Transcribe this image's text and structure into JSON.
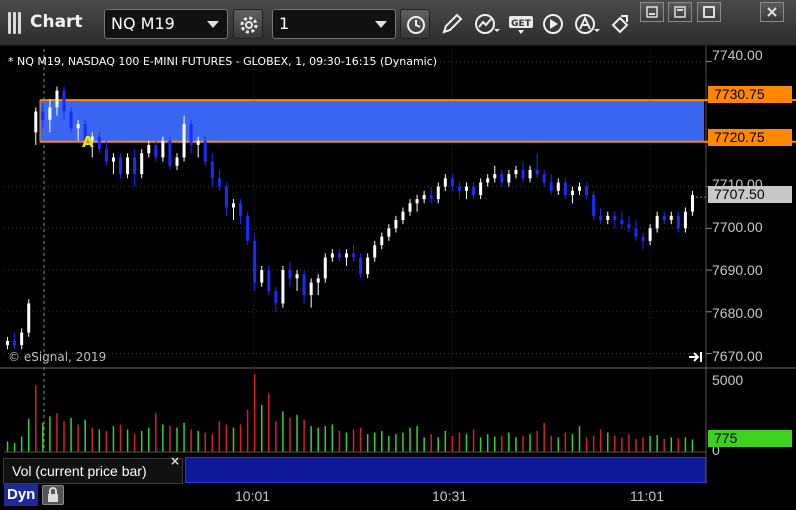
{
  "window": {
    "title": "Chart",
    "symbol": "NQ M19",
    "interval": "1"
  },
  "toolbar": {
    "icons": [
      "settings-gear-icon",
      "clock-icon",
      "pencil-draw-icon",
      "study-icon",
      "get-data-icon",
      "play-icon",
      "alert-icon",
      "link-icon"
    ]
  },
  "chart": {
    "description": "* NQ M19, NASDAQ 100 E-MINI FUTURES - GLOBEX, 1, 09:30-16:15 (Dynamic)",
    "copyright": "© eSignal, 2019",
    "marker": "A",
    "price_axis": [
      "7740.00",
      "7710.00",
      "7700.00",
      "7690.00",
      "7680.00",
      "7670.00"
    ],
    "zone_top_label": "7730.75",
    "zone_bottom_label": "7720.75",
    "last_price_label": "7707.50",
    "time_axis": [
      "10:01",
      "10:31",
      "11:01"
    ],
    "colors": {
      "up": "#ffffff",
      "down": "#1a2bff",
      "zone": "#3d6bff",
      "zone_border": "#ff8800",
      "volume_up": "#2fd62f",
      "volume_down": "#d82020"
    }
  },
  "volume": {
    "label": "Vol (current price bar)",
    "close": "×",
    "axis_max": "5000",
    "axis_min": "0",
    "current_label": "775"
  },
  "footer": {
    "mode": "Dyn"
  },
  "chart_data": {
    "type": "candlestick",
    "y_range": [
      7667,
      7743
    ],
    "zone": [
      7720.75,
      7730.75
    ],
    "last": 7707.5,
    "price_axis_values": [
      7740,
      7710,
      7700,
      7690,
      7680,
      7670
    ],
    "time_ticks": [
      "10:01",
      "10:31",
      "11:01"
    ],
    "candles": [
      [
        7672,
        7674,
        7671,
        7673
      ],
      [
        7673,
        7675,
        7671,
        7672
      ],
      [
        7672,
        7676,
        7671,
        7675
      ],
      [
        7675,
        7683,
        7674,
        7682
      ],
      [
        7723,
        7729,
        7720,
        7728
      ],
      [
        7728,
        7730,
        7724,
        7726
      ],
      [
        7726,
        7731,
        7723,
        7729
      ],
      [
        7729,
        7734,
        7727,
        7733
      ],
      [
        7733,
        7734,
        7726,
        7728
      ],
      [
        7728,
        7729,
        7723,
        7724
      ],
      [
        7724,
        7726,
        7721,
        7725
      ],
      [
        7725,
        7726,
        7720,
        7721
      ],
      [
        7721,
        7723,
        7717,
        7722
      ],
      [
        7722,
        7723,
        7718,
        7719
      ],
      [
        7719,
        7721,
        7715,
        7716
      ],
      [
        7716,
        7718,
        7713,
        7717
      ],
      [
        7717,
        7718,
        7712,
        7713
      ],
      [
        7713,
        7718,
        7712,
        7717
      ],
      [
        7717,
        7719,
        7710,
        7713
      ],
      [
        7713,
        7719,
        7712,
        7718
      ],
      [
        7718,
        7721,
        7717,
        7720
      ],
      [
        7720,
        7721,
        7716,
        7717
      ],
      [
        7717,
        7722,
        7716,
        7721
      ],
      [
        7721,
        7722,
        7714,
        7715
      ],
      [
        7715,
        7718,
        7714,
        7717
      ],
      [
        7717,
        7727,
        7716,
        7725
      ],
      [
        7725,
        7726,
        7718,
        7720
      ],
      [
        7720,
        7722,
        7717,
        7721
      ],
      [
        7721,
        7722,
        7715,
        7716
      ],
      [
        7716,
        7718,
        7710,
        7712
      ],
      [
        7712,
        7714,
        7709,
        7710
      ],
      [
        7710,
        7711,
        7703,
        7705
      ],
      [
        7705,
        7707,
        7702,
        7706
      ],
      [
        7706,
        7707,
        7701,
        7703
      ],
      [
        7703,
        7704,
        7696,
        7697
      ],
      [
        7697,
        7699,
        7685,
        7687
      ],
      [
        7687,
        7691,
        7686,
        7690
      ],
      [
        7690,
        7691,
        7684,
        7685
      ],
      [
        7685,
        7686,
        7680,
        7682
      ],
      [
        7682,
        7691,
        7681,
        7690
      ],
      [
        7690,
        7692,
        7686,
        7688
      ],
      [
        7688,
        7690,
        7685,
        7689
      ],
      [
        7689,
        7690,
        7682,
        7684
      ],
      [
        7684,
        7688,
        7681,
        7687
      ],
      [
        7687,
        7689,
        7684,
        7688
      ],
      [
        7688,
        7694,
        7687,
        7693
      ],
      [
        7693,
        7695,
        7692,
        7694
      ],
      [
        7694,
        7695,
        7692,
        7693
      ],
      [
        7693,
        7695,
        7691,
        7694
      ],
      [
        7694,
        7696,
        7692,
        7693
      ],
      [
        7693,
        7694,
        7688,
        7689
      ],
      [
        7689,
        7694,
        7688,
        7693
      ],
      [
        7693,
        7697,
        7692,
        7696
      ],
      [
        7696,
        7699,
        7695,
        7698
      ],
      [
        7698,
        7701,
        7697,
        7700
      ],
      [
        7700,
        7703,
        7699,
        7702
      ],
      [
        7702,
        7705,
        7701,
        7704
      ],
      [
        7704,
        7707,
        7703,
        7706
      ],
      [
        7706,
        7708,
        7704,
        7707
      ],
      [
        7707,
        7709,
        7706,
        7708
      ],
      [
        7708,
        7710,
        7706,
        7707
      ],
      [
        7707,
        7711,
        7706,
        7710
      ],
      [
        7710,
        7713,
        7709,
        7712
      ],
      [
        7712,
        7713,
        7709,
        7710
      ],
      [
        7710,
        7711,
        7707,
        7709
      ],
      [
        7709,
        7711,
        7707,
        7710
      ],
      [
        7710,
        7711,
        7707,
        7708
      ],
      [
        7708,
        7712,
        7707,
        7711
      ],
      [
        7711,
        7713,
        7710,
        7712
      ],
      [
        7712,
        7715,
        7711,
        7713
      ],
      [
        7713,
        7714,
        7710,
        7711
      ],
      [
        7711,
        7714,
        7710,
        7713
      ],
      [
        7713,
        7715,
        7712,
        7714
      ],
      [
        7714,
        7716,
        7711,
        7712
      ],
      [
        7712,
        7715,
        7711,
        7714
      ],
      [
        7714,
        7718,
        7712,
        7713
      ],
      [
        7713,
        7714,
        7710,
        7711
      ],
      [
        7711,
        7713,
        7708,
        7709
      ],
      [
        7709,
        7712,
        7708,
        7711
      ],
      [
        7711,
        7712,
        7707,
        7708
      ],
      [
        7708,
        7710,
        7706,
        7709
      ],
      [
        7709,
        7711,
        7708,
        7710
      ],
      [
        7710,
        7711,
        7707,
        7708
      ],
      [
        7708,
        7709,
        7702,
        7703
      ],
      [
        7703,
        7705,
        7701,
        7702
      ],
      [
        7702,
        7704,
        7701,
        7703
      ],
      [
        7703,
        7704,
        7700,
        7702
      ],
      [
        7702,
        7704,
        7700,
        7701
      ],
      [
        7701,
        7703,
        7699,
        7700
      ],
      [
        7700,
        7702,
        7697,
        7698
      ],
      [
        7698,
        7699,
        7695,
        7697
      ],
      [
        7697,
        7701,
        7696,
        7700
      ],
      [
        7700,
        7704,
        7699,
        7703
      ],
      [
        7703,
        7704,
        7701,
        7702
      ],
      [
        7702,
        7704,
        7701,
        7703
      ],
      [
        7703,
        7704,
        7699,
        7700
      ],
      [
        7700,
        7705,
        7699,
        7704
      ],
      [
        7704,
        7709,
        7703,
        7708
      ]
    ],
    "volume": [
      650,
      560,
      960,
      2050,
      4100,
      1800,
      2200,
      2400,
      1900,
      2100,
      1700,
      2000,
      1500,
      1400,
      1300,
      1600,
      1700,
      1400,
      1100,
      1300,
      1500,
      2400,
      1700,
      1600,
      1500,
      1800,
      1400,
      1300,
      1200,
      1100,
      1900,
      1700,
      1500,
      1700,
      2600,
      4800,
      2900,
      3600,
      1900,
      2500,
      2100,
      2300,
      2000,
      1600,
      1500,
      1600,
      1700,
      1300,
      1200,
      1400,
      1500,
      1100,
      1200,
      1300,
      1000,
      1100,
      1200,
      1500,
      1600,
      900,
      1100,
      900,
      1300,
      1000,
      1200,
      1100,
      1400,
      900,
      1100,
      950,
      1000,
      1200,
      900,
      1000,
      1100,
      1300,
      1800,
      1000,
      900,
      1200,
      1100,
      1600,
      900,
      1000,
      1400,
      1200,
      1000,
      900,
      1100,
      800,
      900,
      1000,
      1050,
      800,
      900,
      850,
      900,
      775
    ],
    "volume_up": [
      1,
      1,
      1,
      1,
      0,
      1,
      1,
      0,
      0,
      1,
      0,
      1,
      0,
      1,
      0,
      1,
      0,
      1,
      0,
      1,
      1,
      0,
      1,
      0,
      1,
      1,
      0,
      1,
      0,
      0,
      0,
      0,
      1,
      0,
      0,
      0,
      1,
      0,
      0,
      1,
      0,
      1,
      0,
      1,
      1,
      1,
      1,
      0,
      1,
      0,
      0,
      1,
      1,
      1,
      1,
      1,
      1,
      1,
      1,
      1,
      0,
      1,
      1,
      0,
      0,
      1,
      0,
      1,
      1,
      1,
      0,
      1,
      1,
      0,
      1,
      0,
      0,
      0,
      1,
      0,
      1,
      1,
      0,
      0,
      0,
      1,
      0,
      0,
      0,
      0,
      0,
      1,
      1,
      0,
      1,
      0,
      1,
      1
    ]
  }
}
